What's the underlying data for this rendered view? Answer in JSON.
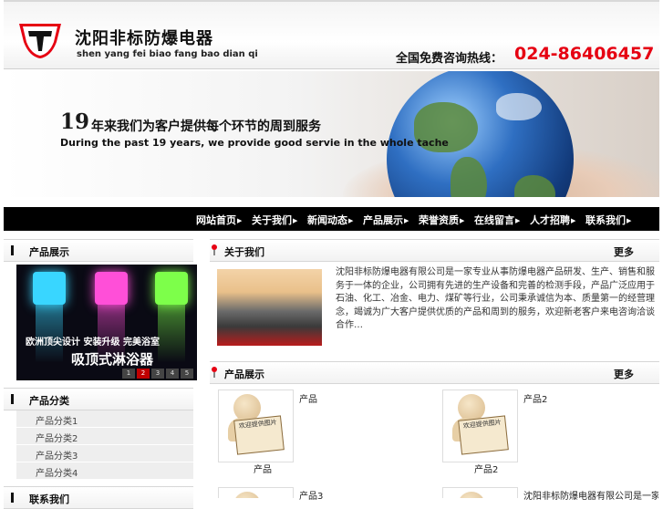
{
  "header": {
    "brand_cn": "沈阳非标防爆电器",
    "brand_en": "shen yang fei biao fang bao dian qi",
    "hotline_label": "全国免费咨询热线：",
    "hotline_number": "024-86406457",
    "logo_icon": "t-shield-logo-icon"
  },
  "banner": {
    "years": "19",
    "tagline_cn": "年来我们为客户提供每个环节的周到服务",
    "tagline_en": "During the past 19 years, we provide good servie in the whole tache"
  },
  "nav": {
    "items": [
      "网站首页",
      "关于我们",
      "新闻动态",
      "产品展示",
      "荣誉资质",
      "在线留言",
      "人才招聘",
      "联系我们"
    ]
  },
  "left": {
    "product_panel_title": "产品展示",
    "slide_line1": "欧洲顶尖设计  安装升级  完美浴室",
    "slide_line2": "吸顶式淋浴器",
    "slide_pages": [
      "1",
      "2",
      "3",
      "4",
      "5"
    ],
    "slide_active_page": "2",
    "category_panel_title": "产品分类",
    "categories": [
      "产品分类1",
      "产品分类2",
      "产品分类3",
      "产品分类4"
    ],
    "third_panel_title": "联系我们"
  },
  "right": {
    "about": {
      "title": "关于我们",
      "more": "更多",
      "text": "沈阳非标防爆电器有限公司是一家专业从事防爆电器产品研发、生产、销售和服务于一体的企业，公司拥有先进的生产设备和完善的检测手段，产品广泛应用于石油、化工、冶金、电力、煤矿等行业，公司秉承诚信为本、质量第一的经营理念，竭诚为广大客户提供优质的产品和周到的服务，欢迎新老客户来电咨询洽谈合作…"
    },
    "products": {
      "title": "产品展示",
      "more": "更多",
      "items": [
        {
          "caption": "产品",
          "side": "产品",
          "sign": "欢迎提供图片"
        },
        {
          "caption": "产品2",
          "side": "产品2",
          "sign": "欢迎提供图片"
        }
      ],
      "row2_side": "产品3",
      "row2_side_right": "沈阳非标防爆电器有限公司是一家专业从事防爆电器产品"
    }
  },
  "colors": {
    "accent_red": "#e60012",
    "nav_bg": "#000000"
  }
}
